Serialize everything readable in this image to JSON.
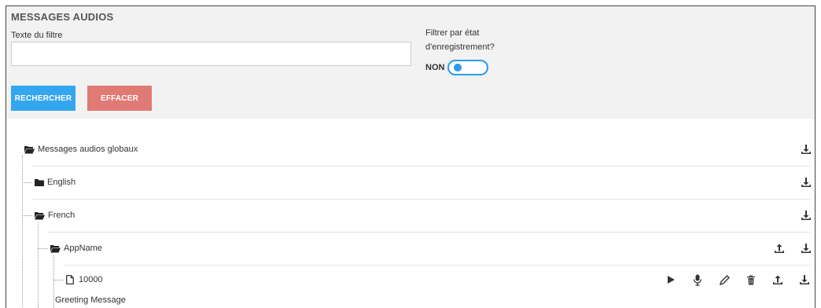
{
  "panel": {
    "title": "MESSAGES AUDIOS",
    "filter_label": "Texte du filtre",
    "filter_value": "",
    "state_filter_label_line1": "Filtrer par état",
    "state_filter_label_line2": "d'enregistrement?",
    "toggle_text": "NON",
    "toggle_on": false,
    "search_button": "RECHERCHER",
    "clear_button": "EFFACER",
    "accent_color": "#33a6f0",
    "danger_color": "#e07a74"
  },
  "tree": {
    "root": {
      "label": "Messages audios globaux",
      "icon": "folder-open-icon"
    },
    "english": {
      "label": "English",
      "icon": "folder-icon"
    },
    "french": {
      "label": "French",
      "icon": "folder-open-icon"
    },
    "appname": {
      "label": "AppName",
      "icon": "folder-open-icon"
    },
    "file": {
      "label": "10000",
      "icon": "file-icon",
      "description": "Greeting Message"
    }
  }
}
